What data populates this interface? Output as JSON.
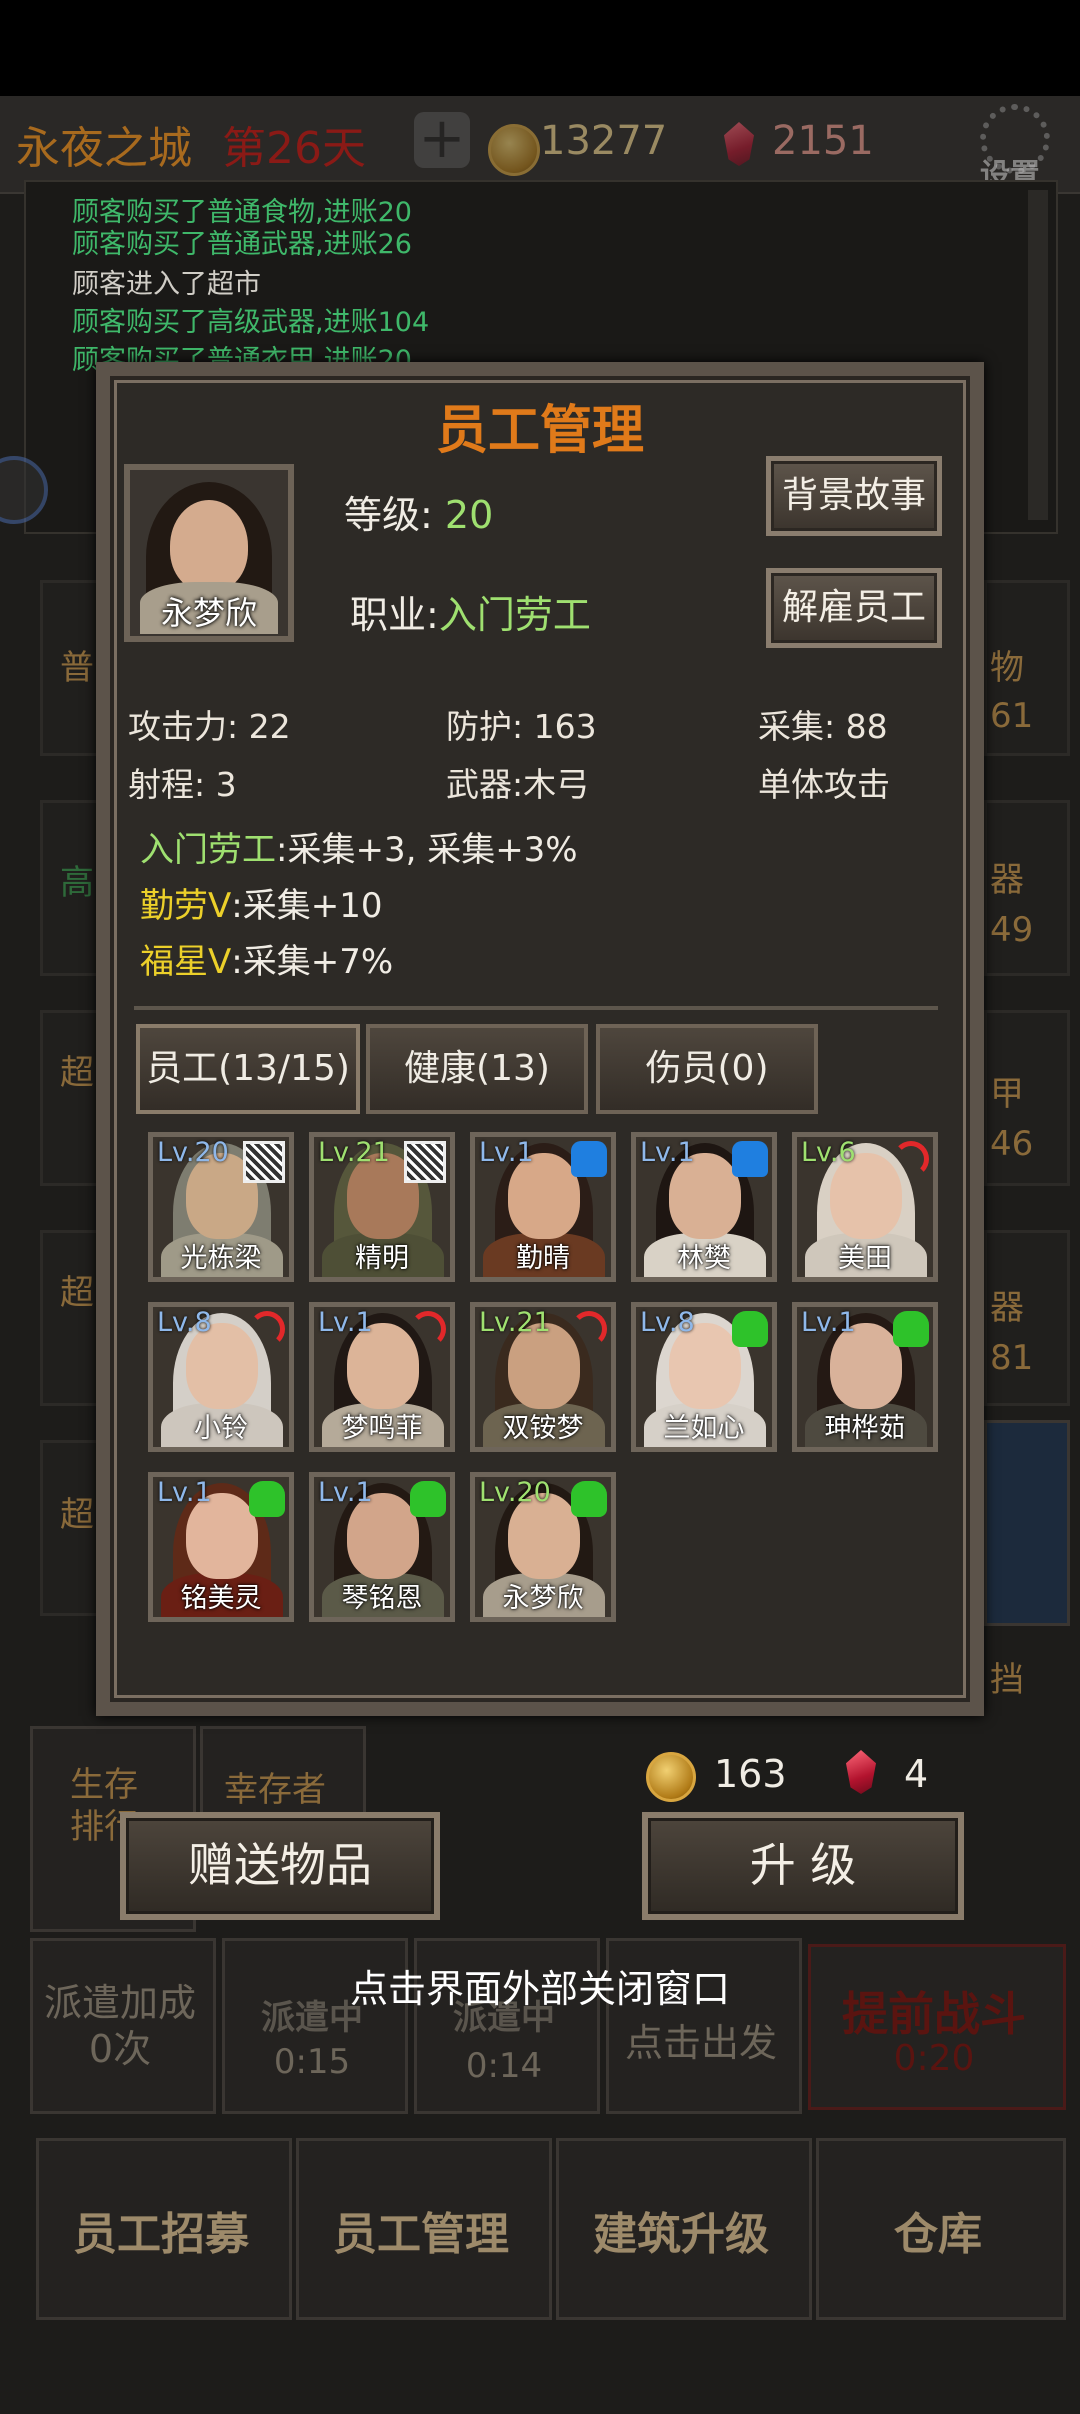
{
  "status_bar": {},
  "topbar": {
    "title": "永夜之城",
    "day": "第26天",
    "gold": "13277",
    "gems": "2151",
    "settings_label": "设置"
  },
  "log": [
    {
      "text": "顾客购买了普通食物,进账20",
      "tone": "g"
    },
    {
      "text": "顾客购买了普通武器,进账26",
      "tone": "g"
    },
    {
      "text": "顾客进入了超市",
      "tone": "w"
    },
    {
      "text": "顾客购买了高级武器,进账104",
      "tone": "g"
    },
    {
      "text": "顾客购买了普通衣甲,进账20",
      "tone": "g"
    }
  ],
  "background": {
    "left_labels": [
      "普",
      "高",
      "超",
      "超",
      "超"
    ],
    "right_labels": [
      "物",
      "器",
      "甲",
      "器"
    ],
    "right_values": [
      "61",
      "49",
      "46",
      "81"
    ],
    "right_extra": "挡",
    "survive_rank": "生存排行",
    "survivor": "幸存者",
    "dispatch_bonus": "派遣加成",
    "dispatch_count": "0次",
    "dispatch_1": "派遣中",
    "dispatch_1_time": "0:15",
    "dispatch_2": "派遣中",
    "dispatch_2_time": "0:14",
    "dispatch_3": "点击出发",
    "battle": "提前战斗",
    "battle_time": "0:20",
    "nav": [
      "员工招募",
      "员工管理",
      "建筑升级",
      "仓库"
    ]
  },
  "dialog": {
    "title": "员工管理",
    "employee_name": "永梦欣",
    "level_label": "等级:",
    "level_value": "20",
    "job_label": "职业:",
    "job_value": "入门劳工",
    "btn_story": "背景故事",
    "btn_fire": "解雇员工",
    "stats": {
      "attack": "攻击力: 22",
      "defense": "防护: 163",
      "gather": "采集: 88",
      "range": "射程: 3",
      "weapon": "武器:木弓",
      "attack_type": "单体攻击"
    },
    "traits": [
      {
        "name": "入门劳工",
        "effect": ":采集+3, 采集+3%",
        "color": "t-green"
      },
      {
        "name": "勤劳Ⅴ",
        "effect": ":采集+10",
        "color": "t-yellow"
      },
      {
        "name": "福星Ⅴ",
        "effect": ":采集+7%",
        "color": "t-yellow"
      }
    ],
    "tabs": [
      "员工(13/15)",
      "健康(13)",
      "伤员(0)"
    ],
    "employees": [
      {
        "lv": "Lv.20",
        "name": "光栋梁",
        "role": "net",
        "lvc": "b",
        "skin": "#c9a886",
        "hair": "#7e7d70",
        "body": "#9f9a88"
      },
      {
        "lv": "Lv.21",
        "name": "精明",
        "role": "net",
        "lvc": "g",
        "skin": "#a8795a",
        "hair": "#56573b",
        "body": "#4e4f36"
      },
      {
        "lv": "Lv.1",
        "name": "勤晴",
        "role": "fist",
        "lvc": "b",
        "skin": "#d7a888",
        "hair": "#2b1d17",
        "body": "#6a3a22"
      },
      {
        "lv": "Lv.1",
        "name": "林樊",
        "role": "fist",
        "lvc": "b",
        "skin": "#d9b094",
        "hair": "#1e1612",
        "body": "#d9d2c6"
      },
      {
        "lv": "Lv.6",
        "name": "美田",
        "role": "bow",
        "lvc": "g",
        "skin": "#e6c2aa",
        "hair": "#d9d0c4",
        "body": "#cfc7bb"
      },
      {
        "lv": "Lv.8",
        "name": "小铃",
        "role": "bow",
        "lvc": "b",
        "skin": "#e3bfa6",
        "hair": "#d4cfc8",
        "body": "#cdc6bd"
      },
      {
        "lv": "Lv.1",
        "name": "梦鸣菲",
        "role": "bow",
        "lvc": "b",
        "skin": "#dcb498",
        "hair": "#201814",
        "body": "#b5aa99"
      },
      {
        "lv": "Lv.21",
        "name": "双铵梦",
        "role": "bow",
        "lvc": "g",
        "skin": "#caa080",
        "hair": "#3a2a1e",
        "body": "#6d6450"
      },
      {
        "lv": "Lv.8",
        "name": "兰如心",
        "role": "hand",
        "lvc": "b",
        "skin": "#e8c6b0",
        "hair": "#dcd6cf",
        "body": "#d6d0c8"
      },
      {
        "lv": "Lv.1",
        "name": "珅桦茹",
        "role": "hand",
        "lvc": "b",
        "skin": "#d9b29a",
        "hair": "#241914",
        "body": "#4e4a40"
      },
      {
        "lv": "Lv.1",
        "name": "铭美灵",
        "role": "hand",
        "lvc": "b",
        "skin": "#e2b59c",
        "hair": "#5e2a18",
        "body": "#6a1f14"
      },
      {
        "lv": "Lv.1",
        "name": "琴铭恩",
        "role": "hand",
        "lvc": "b",
        "skin": "#d2a58a",
        "hair": "#231913",
        "body": "#5b5a48"
      },
      {
        "lv": "Lv.20",
        "name": "永梦欣",
        "role": "hand",
        "lvc": "g",
        "skin": "#d9b093",
        "hair": "#221913",
        "body": "#a79d8c"
      }
    ],
    "cost_gold": "163",
    "cost_gem": "4",
    "btn_gift": "赠送物品",
    "btn_upgrade": "升 级"
  },
  "hint": "点击界面外部关闭窗口"
}
